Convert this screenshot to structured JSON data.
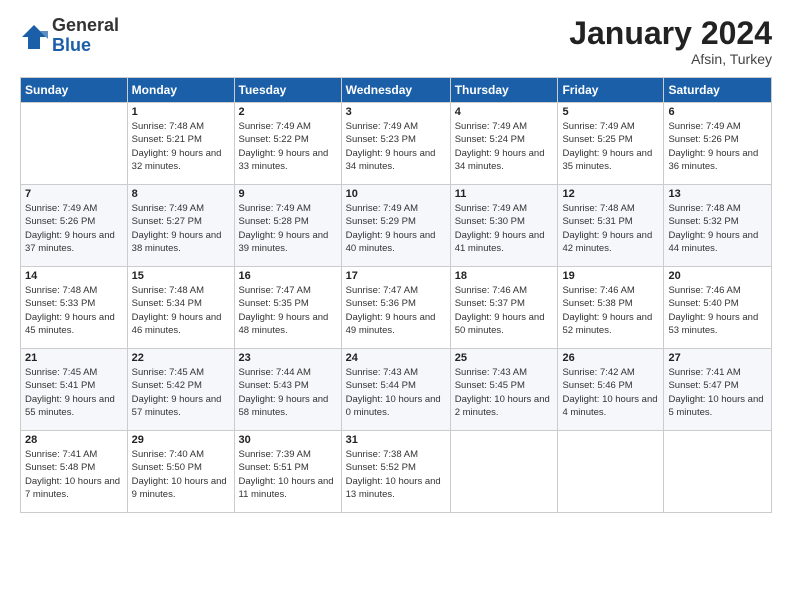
{
  "logo": {
    "general": "General",
    "blue": "Blue"
  },
  "header": {
    "month": "January 2024",
    "location": "Afsin, Turkey"
  },
  "weekdays": [
    "Sunday",
    "Monday",
    "Tuesday",
    "Wednesday",
    "Thursday",
    "Friday",
    "Saturday"
  ],
  "weeks": [
    [
      {
        "day": "",
        "sunrise": "",
        "sunset": "",
        "daylight": ""
      },
      {
        "day": "1",
        "sunrise": "Sunrise: 7:48 AM",
        "sunset": "Sunset: 5:21 PM",
        "daylight": "Daylight: 9 hours and 32 minutes."
      },
      {
        "day": "2",
        "sunrise": "Sunrise: 7:49 AM",
        "sunset": "Sunset: 5:22 PM",
        "daylight": "Daylight: 9 hours and 33 minutes."
      },
      {
        "day": "3",
        "sunrise": "Sunrise: 7:49 AM",
        "sunset": "Sunset: 5:23 PM",
        "daylight": "Daylight: 9 hours and 34 minutes."
      },
      {
        "day": "4",
        "sunrise": "Sunrise: 7:49 AM",
        "sunset": "Sunset: 5:24 PM",
        "daylight": "Daylight: 9 hours and 34 minutes."
      },
      {
        "day": "5",
        "sunrise": "Sunrise: 7:49 AM",
        "sunset": "Sunset: 5:25 PM",
        "daylight": "Daylight: 9 hours and 35 minutes."
      },
      {
        "day": "6",
        "sunrise": "Sunrise: 7:49 AM",
        "sunset": "Sunset: 5:26 PM",
        "daylight": "Daylight: 9 hours and 36 minutes."
      }
    ],
    [
      {
        "day": "7",
        "sunrise": "Sunrise: 7:49 AM",
        "sunset": "Sunset: 5:26 PM",
        "daylight": "Daylight: 9 hours and 37 minutes."
      },
      {
        "day": "8",
        "sunrise": "Sunrise: 7:49 AM",
        "sunset": "Sunset: 5:27 PM",
        "daylight": "Daylight: 9 hours and 38 minutes."
      },
      {
        "day": "9",
        "sunrise": "Sunrise: 7:49 AM",
        "sunset": "Sunset: 5:28 PM",
        "daylight": "Daylight: 9 hours and 39 minutes."
      },
      {
        "day": "10",
        "sunrise": "Sunrise: 7:49 AM",
        "sunset": "Sunset: 5:29 PM",
        "daylight": "Daylight: 9 hours and 40 minutes."
      },
      {
        "day": "11",
        "sunrise": "Sunrise: 7:49 AM",
        "sunset": "Sunset: 5:30 PM",
        "daylight": "Daylight: 9 hours and 41 minutes."
      },
      {
        "day": "12",
        "sunrise": "Sunrise: 7:48 AM",
        "sunset": "Sunset: 5:31 PM",
        "daylight": "Daylight: 9 hours and 42 minutes."
      },
      {
        "day": "13",
        "sunrise": "Sunrise: 7:48 AM",
        "sunset": "Sunset: 5:32 PM",
        "daylight": "Daylight: 9 hours and 44 minutes."
      }
    ],
    [
      {
        "day": "14",
        "sunrise": "Sunrise: 7:48 AM",
        "sunset": "Sunset: 5:33 PM",
        "daylight": "Daylight: 9 hours and 45 minutes."
      },
      {
        "day": "15",
        "sunrise": "Sunrise: 7:48 AM",
        "sunset": "Sunset: 5:34 PM",
        "daylight": "Daylight: 9 hours and 46 minutes."
      },
      {
        "day": "16",
        "sunrise": "Sunrise: 7:47 AM",
        "sunset": "Sunset: 5:35 PM",
        "daylight": "Daylight: 9 hours and 48 minutes."
      },
      {
        "day": "17",
        "sunrise": "Sunrise: 7:47 AM",
        "sunset": "Sunset: 5:36 PM",
        "daylight": "Daylight: 9 hours and 49 minutes."
      },
      {
        "day": "18",
        "sunrise": "Sunrise: 7:46 AM",
        "sunset": "Sunset: 5:37 PM",
        "daylight": "Daylight: 9 hours and 50 minutes."
      },
      {
        "day": "19",
        "sunrise": "Sunrise: 7:46 AM",
        "sunset": "Sunset: 5:38 PM",
        "daylight": "Daylight: 9 hours and 52 minutes."
      },
      {
        "day": "20",
        "sunrise": "Sunrise: 7:46 AM",
        "sunset": "Sunset: 5:40 PM",
        "daylight": "Daylight: 9 hours and 53 minutes."
      }
    ],
    [
      {
        "day": "21",
        "sunrise": "Sunrise: 7:45 AM",
        "sunset": "Sunset: 5:41 PM",
        "daylight": "Daylight: 9 hours and 55 minutes."
      },
      {
        "day": "22",
        "sunrise": "Sunrise: 7:45 AM",
        "sunset": "Sunset: 5:42 PM",
        "daylight": "Daylight: 9 hours and 57 minutes."
      },
      {
        "day": "23",
        "sunrise": "Sunrise: 7:44 AM",
        "sunset": "Sunset: 5:43 PM",
        "daylight": "Daylight: 9 hours and 58 minutes."
      },
      {
        "day": "24",
        "sunrise": "Sunrise: 7:43 AM",
        "sunset": "Sunset: 5:44 PM",
        "daylight": "Daylight: 10 hours and 0 minutes."
      },
      {
        "day": "25",
        "sunrise": "Sunrise: 7:43 AM",
        "sunset": "Sunset: 5:45 PM",
        "daylight": "Daylight: 10 hours and 2 minutes."
      },
      {
        "day": "26",
        "sunrise": "Sunrise: 7:42 AM",
        "sunset": "Sunset: 5:46 PM",
        "daylight": "Daylight: 10 hours and 4 minutes."
      },
      {
        "day": "27",
        "sunrise": "Sunrise: 7:41 AM",
        "sunset": "Sunset: 5:47 PM",
        "daylight": "Daylight: 10 hours and 5 minutes."
      }
    ],
    [
      {
        "day": "28",
        "sunrise": "Sunrise: 7:41 AM",
        "sunset": "Sunset: 5:48 PM",
        "daylight": "Daylight: 10 hours and 7 minutes."
      },
      {
        "day": "29",
        "sunrise": "Sunrise: 7:40 AM",
        "sunset": "Sunset: 5:50 PM",
        "daylight": "Daylight: 10 hours and 9 minutes."
      },
      {
        "day": "30",
        "sunrise": "Sunrise: 7:39 AM",
        "sunset": "Sunset: 5:51 PM",
        "daylight": "Daylight: 10 hours and 11 minutes."
      },
      {
        "day": "31",
        "sunrise": "Sunrise: 7:38 AM",
        "sunset": "Sunset: 5:52 PM",
        "daylight": "Daylight: 10 hours and 13 minutes."
      },
      {
        "day": "",
        "sunrise": "",
        "sunset": "",
        "daylight": ""
      },
      {
        "day": "",
        "sunrise": "",
        "sunset": "",
        "daylight": ""
      },
      {
        "day": "",
        "sunrise": "",
        "sunset": "",
        "daylight": ""
      }
    ]
  ]
}
